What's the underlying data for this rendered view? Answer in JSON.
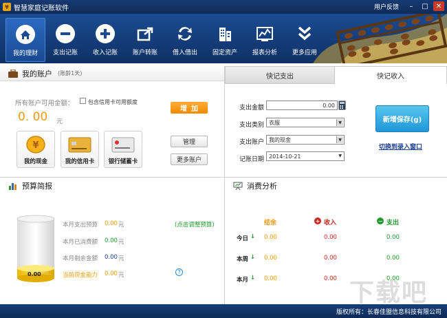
{
  "window": {
    "title": "智慧家庭记账软件",
    "feedback": "用户反馈",
    "controls": [
      "–",
      "□",
      "✕"
    ]
  },
  "toolbar": {
    "items": [
      {
        "label": "我的理财",
        "icon": "home-icon"
      },
      {
        "label": "支出记账",
        "icon": "minus-circle-icon"
      },
      {
        "label": "收入记账",
        "icon": "plus-circle-icon"
      },
      {
        "label": "账户转账",
        "icon": "transfer-icon"
      },
      {
        "label": "借入借出",
        "icon": "swap-icon"
      },
      {
        "label": "固定资产",
        "icon": "building-icon"
      },
      {
        "label": "报表分析",
        "icon": "chart-icon"
      },
      {
        "label": "更多应用",
        "icon": "chevron-double-icon"
      }
    ]
  },
  "accounts": {
    "title": "我的账户",
    "subtitle": "(账龄1天)",
    "available_label": "所有账户可用金额：",
    "include_credit_label": "包含信用卡可用额度",
    "amount": "0. 00",
    "unit": "元",
    "add_button": "增加",
    "manage_button": "管理",
    "more_button": "更多账户",
    "cards": [
      {
        "label": "我的现金",
        "icon": "coin-icon"
      },
      {
        "label": "我的信用卡",
        "icon": "credit-card-icon"
      },
      {
        "label": "银行储蓄卡",
        "icon": "bank-card-icon"
      }
    ]
  },
  "entry": {
    "tabs": [
      "快记支出",
      "快记收入"
    ],
    "fields": {
      "amount_label": "支出金额",
      "amount_value": "0.00",
      "category_label": "支出类别",
      "category_value": "衣服",
      "account_label": "支出账户",
      "account_value": "我的现金",
      "date_label": "记账日期",
      "date_value": "2014-10-21"
    },
    "save_button": "新增保存(g)",
    "switch_link": "切换到录入窗口"
  },
  "budget": {
    "title": "预算简报",
    "gauge_value": "0.00",
    "rows": [
      {
        "label": "本月支出预算",
        "value": "0.00",
        "unit": "元"
      },
      {
        "label": "本月已消费额",
        "value": "0.00",
        "unit": "元"
      },
      {
        "label": "本月剩余金额",
        "value": "0.00",
        "unit": "元"
      },
      {
        "label": "当前现金能力",
        "value": "0.00",
        "unit": "元"
      }
    ],
    "adjust_link": "(点击调整预算)",
    "help": "?"
  },
  "analysis": {
    "title": "消费分析",
    "headers": [
      "结余",
      "收入",
      "支出"
    ],
    "rows": [
      {
        "label": "今日",
        "balance": "0.00",
        "income": "0.00",
        "expense": "0.00"
      },
      {
        "label": "本周",
        "balance": "0.00",
        "income": "0.00",
        "expense": "0.00"
      },
      {
        "label": "本月",
        "balance": "0.00",
        "income": "0.00",
        "expense": "0.00"
      }
    ]
  },
  "status": {
    "copyright": "版权所有：长春佳盟信息科技有限公司"
  },
  "watermark": "下载吧",
  "colors": {
    "toolbar": "#1b4c92",
    "accent_orange": "#f08a00",
    "save_blue": "#1f96d8",
    "income_red": "#c8281e",
    "expense_green": "#1e9a2e"
  }
}
